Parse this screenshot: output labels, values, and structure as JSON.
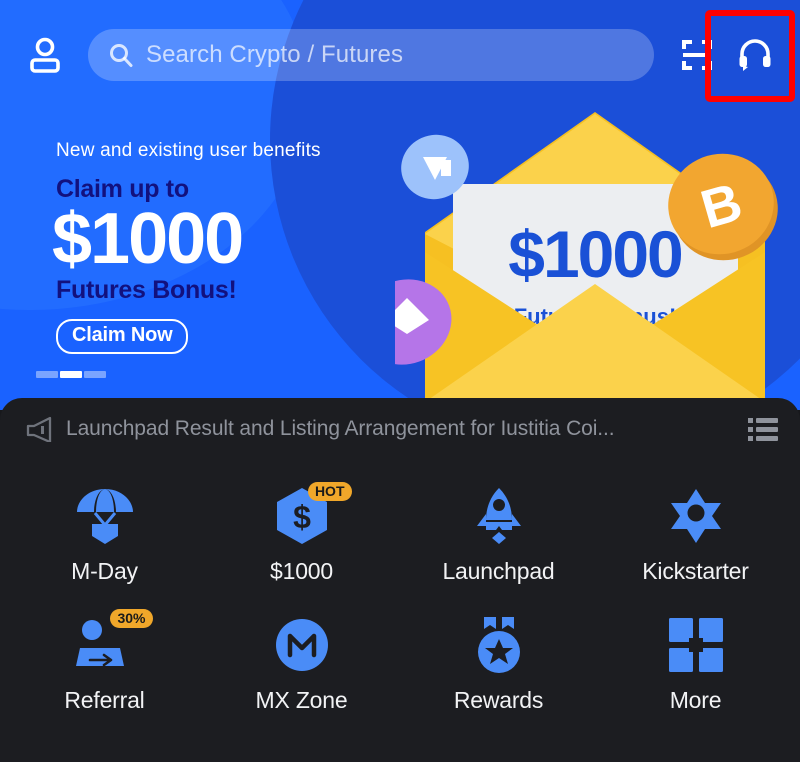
{
  "topbar": {
    "profile_icon": "person-icon",
    "search": {
      "placeholder": "Search Crypto / Futures",
      "icon": "search-icon"
    },
    "scan_icon": "qr-scan-icon",
    "support_icon": "headset-support-icon",
    "highlight_color": "#ff0000"
  },
  "banner": {
    "subtitle": "New and existing user benefits",
    "headline_top": "Claim up to",
    "amount": "$1000",
    "headline_bottom": "Futures Bonus!",
    "cta_label": "Claim Now",
    "envelope_amount": "$1000",
    "envelope_caption": "Futures Bonus!",
    "pager": {
      "total": 3,
      "active_index": 1
    },
    "colors": {
      "background": "#1a62ff",
      "curve_dark": "#1b4fd8",
      "navy_text": "#12117e",
      "envelope_yellow": "#f7c324",
      "bitcoin_orange": "#f2a630",
      "eth_purple": "#b575e8"
    }
  },
  "announcement": {
    "icon": "megaphone-icon",
    "text": "Launchpad Result and Listing Arrangement for Iustitia Coi...",
    "list_icon": "list-icon"
  },
  "quick_actions": [
    {
      "label": "M-Day",
      "icon": "parachute-icon",
      "badge": null
    },
    {
      "label": "$1000",
      "icon": "hexagon-dollar-icon",
      "badge": "HOT"
    },
    {
      "label": "Launchpad",
      "icon": "rocket-icon",
      "badge": null
    },
    {
      "label": "Kickstarter",
      "icon": "star-burst-icon",
      "badge": null
    },
    {
      "label": "Referral",
      "icon": "referral-icon",
      "badge": "30%"
    },
    {
      "label": "MX Zone",
      "icon": "mx-circle-icon",
      "badge": null
    },
    {
      "label": "Rewards",
      "icon": "medal-star-icon",
      "badge": null
    },
    {
      "label": "More",
      "icon": "grid-more-icon",
      "badge": null
    }
  ],
  "theme": {
    "panel_background": "#1c1d21",
    "accent_blue": "#4a8cf7",
    "muted_text": "#8f939c"
  }
}
